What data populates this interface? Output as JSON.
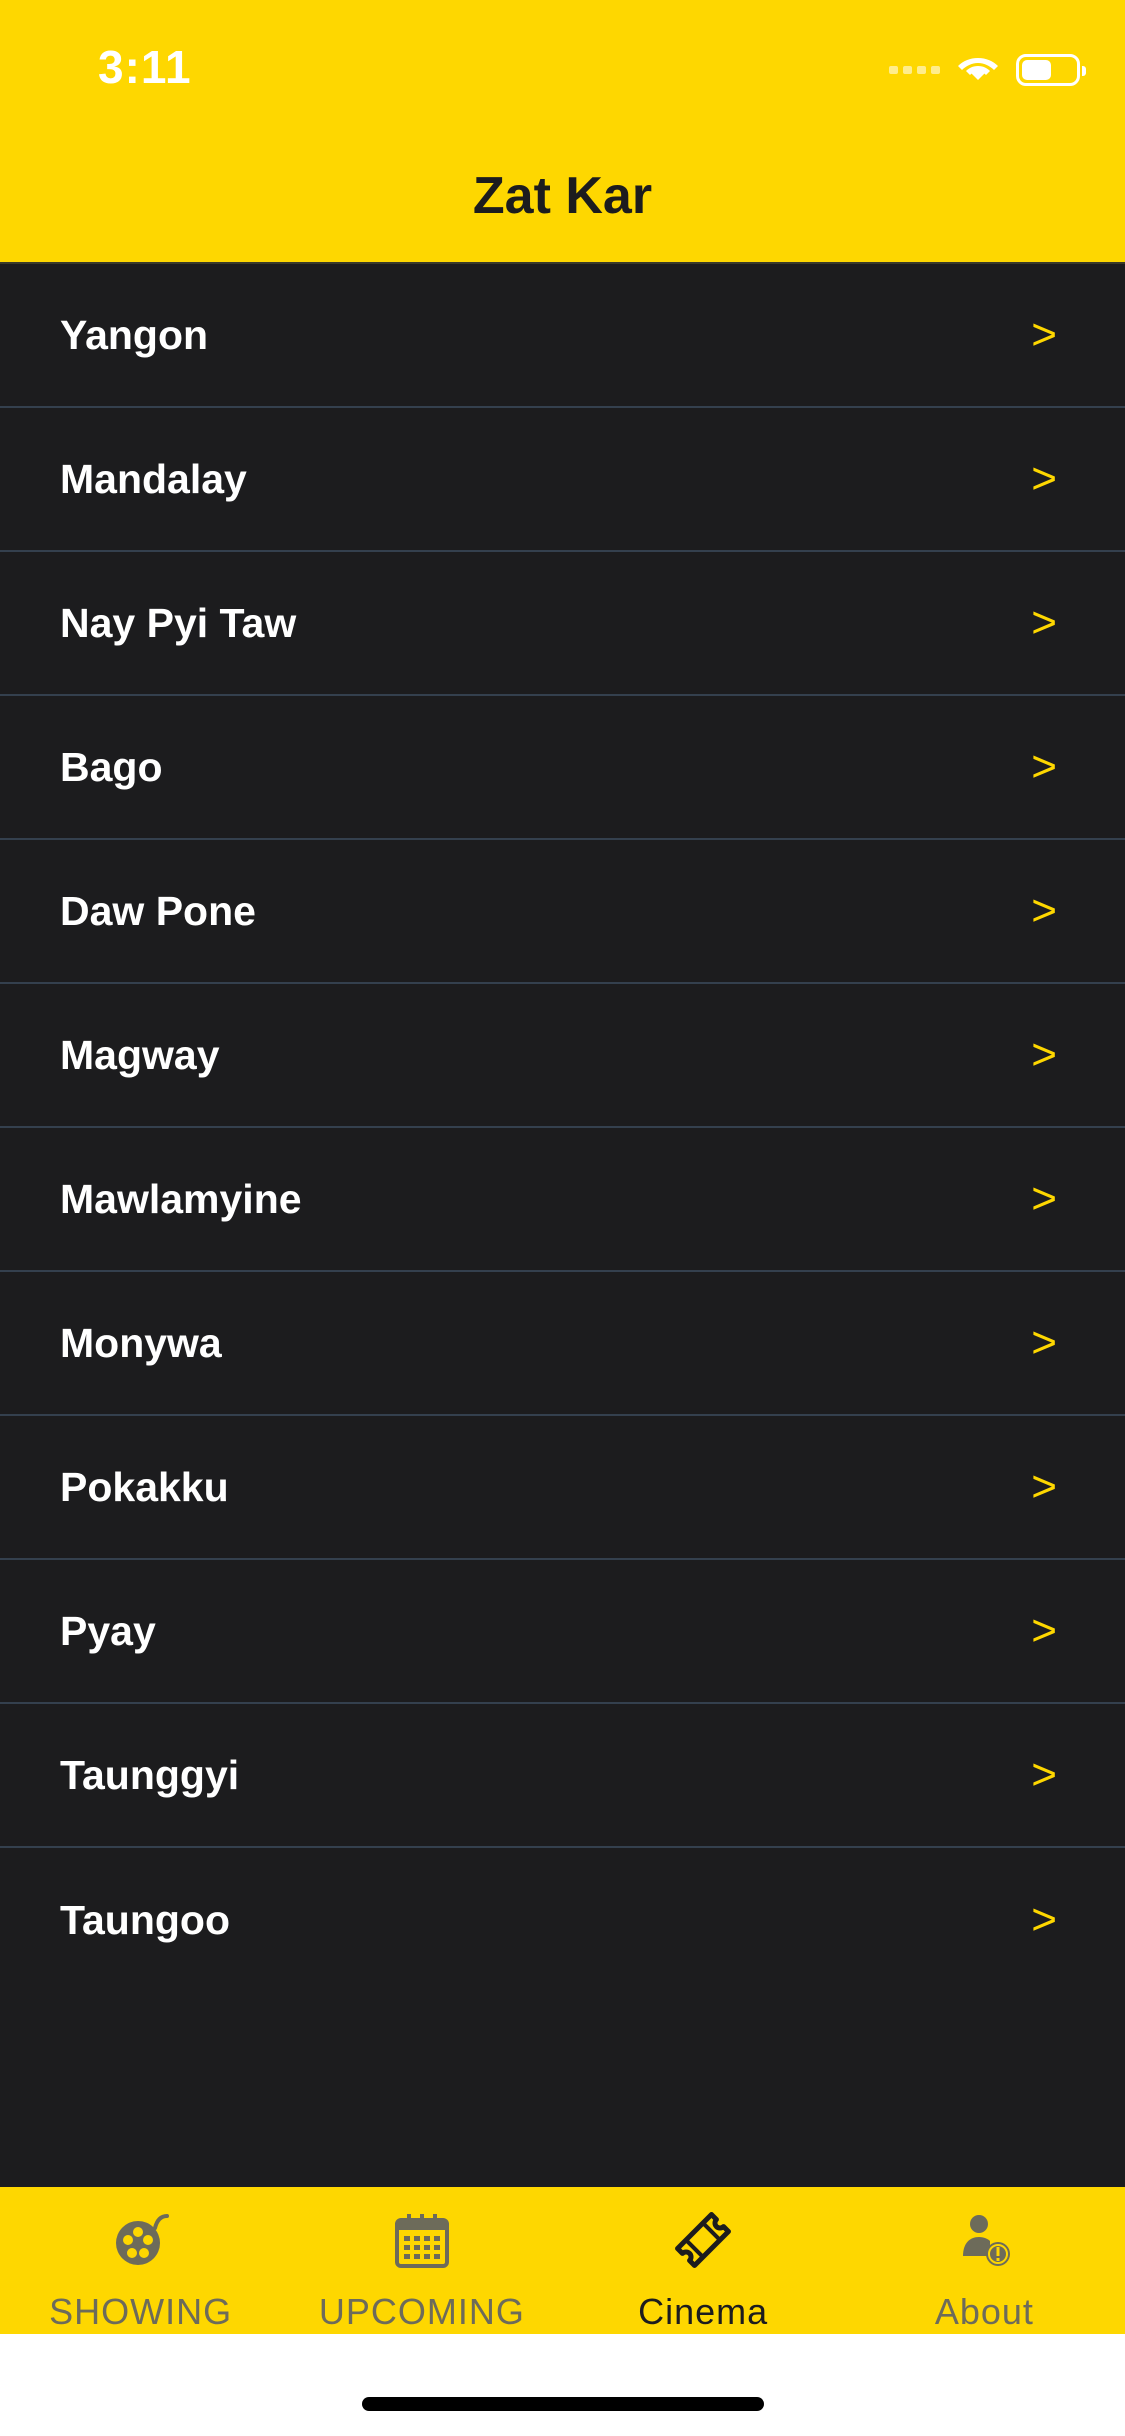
{
  "status_bar": {
    "time": "3:11"
  },
  "header": {
    "title": "Zat Kar"
  },
  "cities": [
    {
      "label": "Yangon",
      "chevron": ">"
    },
    {
      "label": "Mandalay",
      "chevron": ">"
    },
    {
      "label": "Nay Pyi Taw",
      "chevron": ">"
    },
    {
      "label": "Bago",
      "chevron": ">"
    },
    {
      "label": "Daw Pone",
      "chevron": ">"
    },
    {
      "label": "Magway",
      "chevron": ">"
    },
    {
      "label": "Mawlamyine",
      "chevron": ">"
    },
    {
      "label": "Monywa",
      "chevron": ">"
    },
    {
      "label": "Pokakku",
      "chevron": ">"
    },
    {
      "label": "Pyay",
      "chevron": ">"
    },
    {
      "label": "Taunggyi",
      "chevron": ">"
    },
    {
      "label": "Taungoo",
      "chevron": ">"
    }
  ],
  "tabs": [
    {
      "label": "SHOWING",
      "icon": "film-reel-icon",
      "active": false
    },
    {
      "label": "UPCOMING",
      "icon": "calendar-icon",
      "active": false
    },
    {
      "label": "Cinema",
      "icon": "ticket-icon",
      "active": true
    },
    {
      "label": "About",
      "icon": "user-info-icon",
      "active": false
    }
  ],
  "colors": {
    "accent": "#fed700",
    "background": "#1c1c1e",
    "separator": "#34404e",
    "tab_inactive": "#6d6b5a"
  }
}
